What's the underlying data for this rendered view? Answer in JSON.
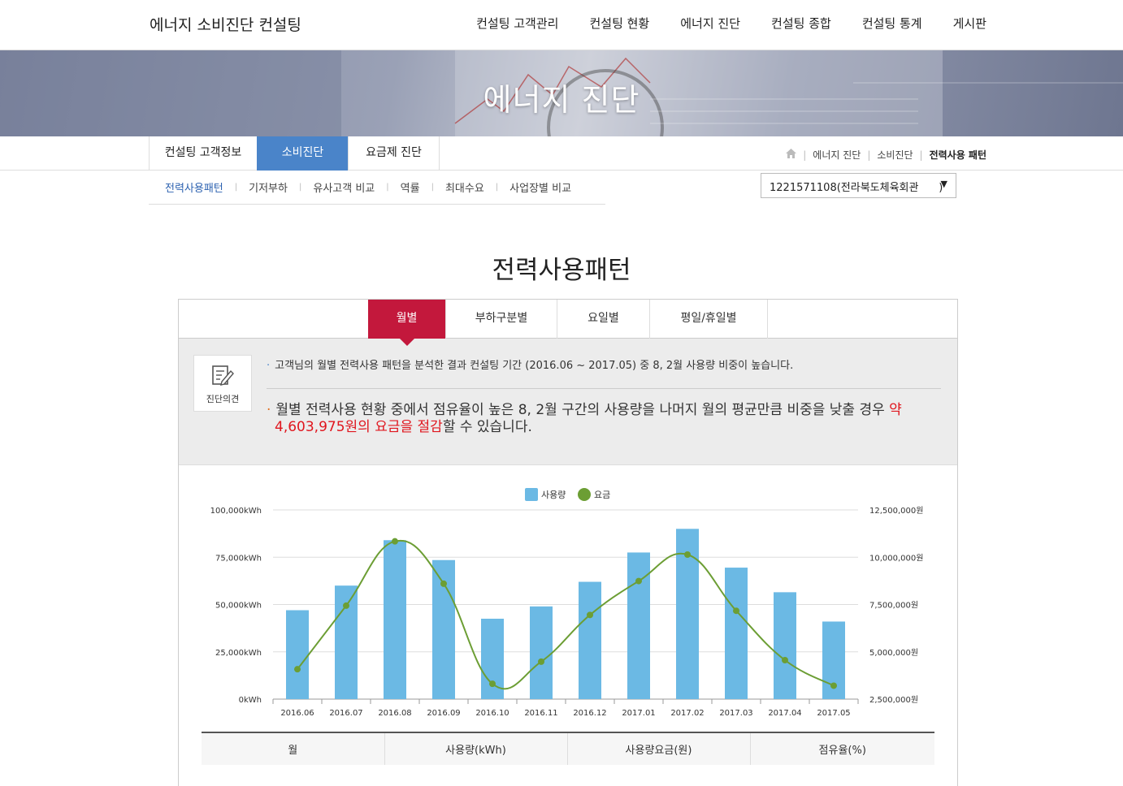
{
  "site": {
    "title": "에너지 소비진단 컨설팅"
  },
  "nav": [
    "컨설팅 고객관리",
    "컨설팅 현황",
    "에너지 진단",
    "컨설팅 종합",
    "컨설팅 통계",
    "게시판"
  ],
  "hero": {
    "title": "에너지 진단"
  },
  "subtabs": [
    {
      "label": "컨설팅 고객정보"
    },
    {
      "label": "소비진단",
      "active": true
    },
    {
      "label": "요금제 진단"
    }
  ],
  "breadcrumb": {
    "items": [
      "에너지 진단",
      "소비진단"
    ],
    "current": "전력사용 패턴"
  },
  "third_menu": [
    {
      "label": "전력사용패턴",
      "active": true
    },
    {
      "label": "기저부하"
    },
    {
      "label": "유사고객 비교"
    },
    {
      "label": "역률"
    },
    {
      "label": "최대수요"
    },
    {
      "label": "사업장별 비교"
    }
  ],
  "customer_select": {
    "value": "1221571108(전라북도체육회관      )"
  },
  "page_title": "전력사용패턴",
  "tabs": [
    {
      "label": "월별",
      "active": true
    },
    {
      "label": "부하구분별"
    },
    {
      "label": "요일별"
    },
    {
      "label": "평일/휴일별"
    }
  ],
  "opinion": {
    "icon_label": "진단의견",
    "line1": "고객님의 월별 전력사용 패턴을 분석한 결과 컨설팅 기간 (2016.06 ~ 2017.05) 중 8, 2월 사용량 비중이 높습니다.",
    "line2_pre": "월별 전력사용 현황 중에서 점유율이 높은 8, 2월 구간의 사용량을 나머지 월의 평균만큼 비중을 낮출 경우 ",
    "line2_hl1": "약 4,603,975원의 요금을 절감",
    "line2_post": "할 수 있습니다."
  },
  "chart_data": {
    "type": "bar+line",
    "legend": [
      "사용량",
      "요금"
    ],
    "categories": [
      "2016.06",
      "2016.07",
      "2016.08",
      "2016.09",
      "2016.10",
      "2016.11",
      "2016.12",
      "2017.01",
      "2017.02",
      "2017.03",
      "2017.04",
      "2017.05"
    ],
    "series": [
      {
        "name": "사용량",
        "type": "bar",
        "axis": "left",
        "color": "#6bb9e4",
        "values": [
          47000,
          60000,
          84000,
          73500,
          42500,
          49000,
          62000,
          77500,
          90000,
          69500,
          56500,
          41000
        ]
      },
      {
        "name": "요금",
        "type": "line",
        "axis": "right",
        "color": "#6c9e34",
        "values": [
          4080000,
          7440000,
          10840000,
          8600000,
          3310000,
          4480000,
          6950000,
          8740000,
          10140000,
          7170000,
          4560000,
          3210000
        ]
      }
    ],
    "left_axis": {
      "ticks": [
        "0kWh",
        "25,000kWh",
        "50,000kWh",
        "75,000kWh",
        "100,000kWh"
      ],
      "min": 0,
      "max": 100000
    },
    "right_axis": {
      "ticks": [
        "2,500,000원",
        "5,000,000원",
        "7,500,000원",
        "10,000,000원",
        "12,500,000원"
      ],
      "min": 2500000,
      "max": 12500000
    }
  },
  "table": {
    "headers": [
      "월",
      "사용량(kWh)",
      "사용량요금(원)",
      "점유율(%)"
    ]
  }
}
